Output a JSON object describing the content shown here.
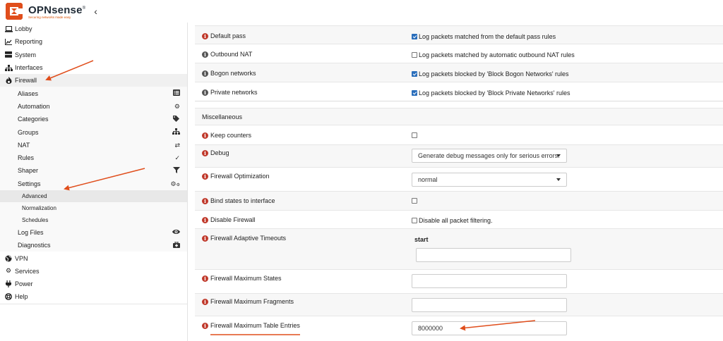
{
  "header": {
    "brand": "OPNsense",
    "brand_mark": "®",
    "tagline": "Securing networks made easy",
    "collapse_icon": "chevron-left-icon"
  },
  "sidebar": {
    "items": [
      {
        "label": "Lobby",
        "icon": "laptop-icon"
      },
      {
        "label": "Reporting",
        "icon": "chart-icon"
      },
      {
        "label": "System",
        "icon": "server-icon"
      },
      {
        "label": "Interfaces",
        "icon": "sitemap-icon"
      },
      {
        "label": "Firewall",
        "icon": "fire-icon"
      }
    ],
    "firewall_sub": [
      {
        "label": "Aliases",
        "icon": "list-icon"
      },
      {
        "label": "Automation",
        "icon": "gear-icon"
      },
      {
        "label": "Categories",
        "icon": "tags-icon"
      },
      {
        "label": "Groups",
        "icon": "sitemap-icon"
      },
      {
        "label": "NAT",
        "icon": "exchange-icon"
      },
      {
        "label": "Rules",
        "icon": "check-icon"
      },
      {
        "label": "Shaper",
        "icon": "filter-icon"
      },
      {
        "label": "Settings",
        "icon": "gears-icon"
      }
    ],
    "settings_sub": [
      {
        "label": "Advanced"
      },
      {
        "label": "Normalization"
      },
      {
        "label": "Schedules"
      }
    ],
    "firewall_tail": [
      {
        "label": "Log Files",
        "icon": "eye-icon"
      },
      {
        "label": "Diagnostics",
        "icon": "medkit-icon"
      }
    ],
    "bottom": [
      {
        "label": "VPN",
        "icon": "globe-icon"
      },
      {
        "label": "Services",
        "icon": "cog-icon"
      },
      {
        "label": "Power",
        "icon": "plug-icon"
      },
      {
        "label": "Help",
        "icon": "lifebuoy-icon"
      }
    ]
  },
  "main": {
    "logging_rows": [
      {
        "label": "Default pass",
        "checked": true,
        "text": "Log packets matched from the default pass rules"
      },
      {
        "label": "Outbound NAT",
        "checked": false,
        "text": "Log packets matched by automatic outbound NAT rules"
      },
      {
        "label": "Bogon networks",
        "checked": true,
        "text": "Log packets blocked by 'Block Bogon Networks' rules"
      },
      {
        "label": "Private networks",
        "checked": true,
        "text": "Log packets blocked by 'Block Private Networks' rules"
      }
    ],
    "section_title": "Miscellaneous",
    "keep_counters": "Keep counters",
    "debug": {
      "label": "Debug",
      "value": "Generate debug messages only for serious errors."
    },
    "optimization": {
      "label": "Firewall Optimization",
      "value": "normal"
    },
    "bind_states": "Bind states to interface",
    "disable_fw": {
      "label": "Disable Firewall",
      "text": "Disable all packet filtering."
    },
    "adaptive": {
      "label": "Firewall Adaptive Timeouts",
      "start_label": "start",
      "start_value": ""
    },
    "max_states": {
      "label": "Firewall Maximum States",
      "value": ""
    },
    "max_frags": {
      "label": "Firewall Maximum Fragments",
      "value": ""
    },
    "max_table": {
      "label": "Firewall Maximum Table Entries",
      "value": "8000000"
    }
  },
  "colors": {
    "accent": "#e04e1c",
    "info": "#c0392b",
    "checkbox": "#2a6ebb"
  }
}
